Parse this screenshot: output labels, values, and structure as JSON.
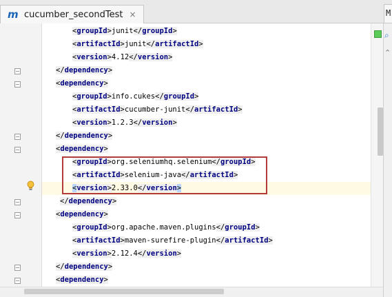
{
  "tab": {
    "icon": "maven-m-icon",
    "icon_text": "m",
    "title": "cucumber_secondTest",
    "close": "×"
  },
  "side_tab_label": "M",
  "code_lines": [
    {
      "kind": "el",
      "tag": "groupId",
      "text": "junit"
    },
    {
      "kind": "el",
      "tag": "artifactId",
      "text": "junit"
    },
    {
      "kind": "el",
      "tag": "version",
      "text": "4.12"
    },
    {
      "kind": "close",
      "tag": "dependency"
    },
    {
      "kind": "open",
      "tag": "dependency"
    },
    {
      "kind": "el",
      "tag": "groupId",
      "text": "info.cukes"
    },
    {
      "kind": "el",
      "tag": "artifactId",
      "text": "cucumber-junit"
    },
    {
      "kind": "el",
      "tag": "version",
      "text": "1.2.3"
    },
    {
      "kind": "close",
      "tag": "dependency"
    },
    {
      "kind": "open",
      "tag": "dependency"
    },
    {
      "kind": "el",
      "tag": "groupId",
      "text": "org.seleniumhq.selenium"
    },
    {
      "kind": "el",
      "tag": "artifactId",
      "text": "selenium-java"
    },
    {
      "kind": "el",
      "tag": "version",
      "text": "2.33.0"
    },
    {
      "kind": "close",
      "tag": "dependency"
    },
    {
      "kind": "open",
      "tag": "dependency"
    },
    {
      "kind": "el",
      "tag": "groupId",
      "text": "org.apache.maven.plugins"
    },
    {
      "kind": "el",
      "tag": "artifactId",
      "text": "maven-surefire-plugin"
    },
    {
      "kind": "el",
      "tag": "version",
      "text": "2.12.4"
    },
    {
      "kind": "close",
      "tag": "dependency"
    },
    {
      "kind": "open",
      "tag": "dependency"
    }
  ],
  "current_line_index": 12,
  "highlighted_range": {
    "from_line": 10,
    "to_line": 12
  },
  "colors": {
    "tag": "#000080",
    "current_line": "#fffae3",
    "highlight_box": "#b23a3a",
    "ok_marker": "#5acb58"
  }
}
